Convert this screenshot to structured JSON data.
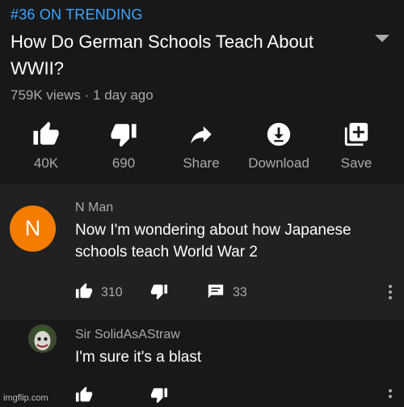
{
  "video": {
    "trending": "#36 ON TRENDING",
    "title": "How Do German Schools Teach About WWII?",
    "meta": "759K views · 1 day ago"
  },
  "actions": [
    {
      "label": "40K",
      "icon": "thumbs-up-icon"
    },
    {
      "label": "690",
      "icon": "thumbs-down-icon"
    },
    {
      "label": "Share",
      "icon": "share-icon"
    },
    {
      "label": "Download",
      "icon": "download-icon"
    },
    {
      "label": "Save",
      "icon": "add-to-playlist-icon"
    }
  ],
  "comments": [
    {
      "avatar_letter": "N",
      "avatar_color": "#f57c00",
      "author": "N Man",
      "text": "Now I'm wondering about how Japanese schools teach World War 2",
      "likes": "310",
      "replies": "33"
    },
    {
      "author": "Sir SolidAsAStraw",
      "text": "I'm sure it's a blast"
    }
  ],
  "watermark": "imgflip.com",
  "colors": {
    "accent": "#3ea6ff",
    "secondary_text": "#aaaaaa",
    "comment_bg": "#212121",
    "page_bg": "#181818"
  }
}
